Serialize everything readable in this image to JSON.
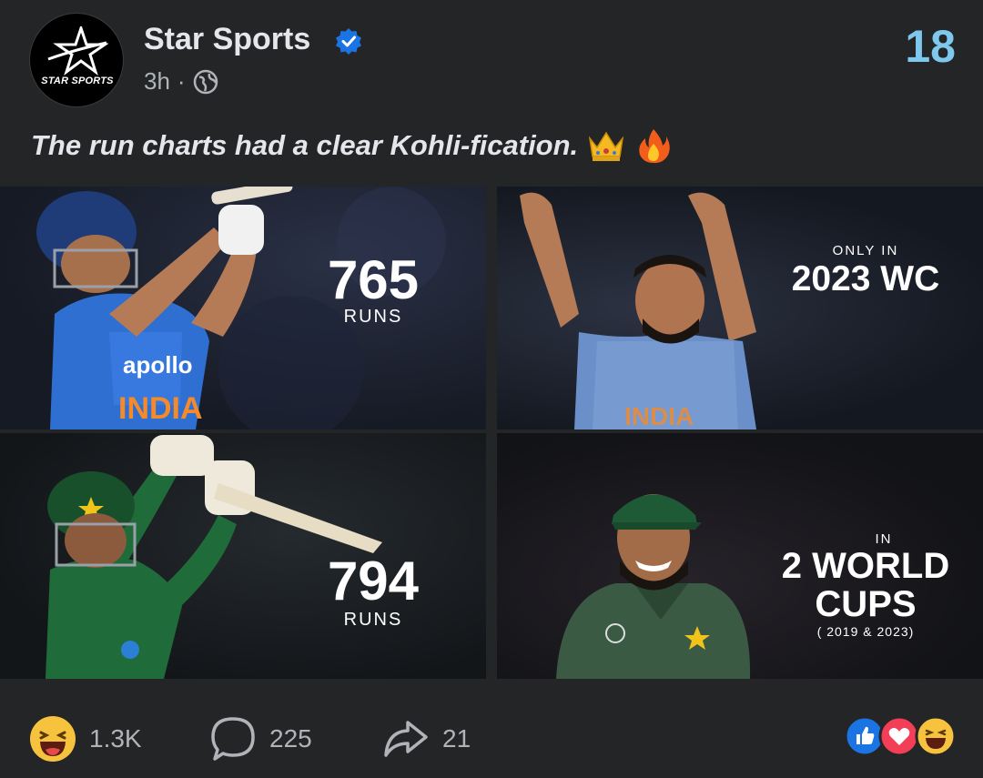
{
  "post": {
    "page_name": "Star Sports",
    "logo_text": "STAR SPORTS",
    "time": "3h",
    "separator": "·",
    "counter": "18",
    "caption": "The run charts had a clear Kohli-fication."
  },
  "tiles": [
    {
      "big": "765",
      "small": "RUNS"
    },
    {
      "pre": "ONLY IN",
      "big": "2023 WC"
    },
    {
      "big": "794",
      "small": "RUNS"
    },
    {
      "pre": "IN",
      "big_line1": "2 WORLD",
      "big_line2": "CUPS",
      "sub": "( 2019 & 2023)"
    }
  ],
  "footer": {
    "reaction_count": "1.3K",
    "comments": "225",
    "shares": "21"
  },
  "colors": {
    "accent": "#7ec8ee",
    "verified": "#1b74e4",
    "india_blue": "#2f6fd1",
    "pakistan_green": "#1f6b3a"
  }
}
